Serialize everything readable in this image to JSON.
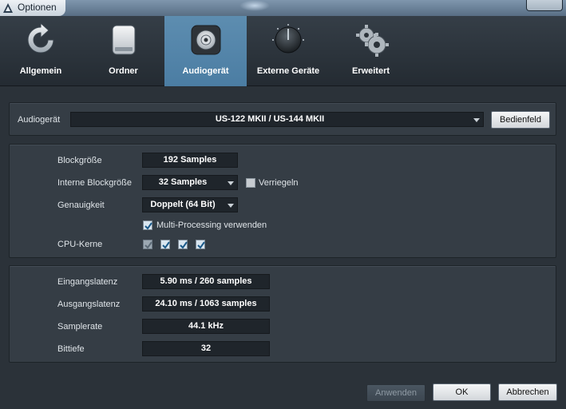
{
  "window": {
    "title": "Optionen"
  },
  "tabs": [
    {
      "label": "Allgemein",
      "icon": "refresh-icon"
    },
    {
      "label": "Ordner",
      "icon": "drive-icon"
    },
    {
      "label": "Audiogerät",
      "icon": "speaker-icon"
    },
    {
      "label": "Externe Geräte",
      "icon": "knob-icon"
    },
    {
      "label": "Erweitert",
      "icon": "gears-icon"
    }
  ],
  "active_tab": "Audiogerät",
  "device": {
    "label": "Audiogerät",
    "value": "US-122 MKII / US-144 MKII",
    "control_panel_button": "Bedienfeld"
  },
  "settings": {
    "block_size_label": "Blockgröße",
    "block_size_value": "192 Samples",
    "internal_block_size_label": "Interne Blockgröße",
    "internal_block_size_value": "32 Samples",
    "lock_label": "Verriegeln",
    "lock_checked": false,
    "precision_label": "Genauigkeit",
    "precision_value": "Doppelt (64 Bit)",
    "multiprocessing_label": "Multi-Processing verwenden",
    "multiprocessing_checked": true,
    "cpu_cores_label": "CPU-Kerne",
    "cpu_cores_checked": [
      true,
      true,
      true,
      true
    ]
  },
  "info": {
    "input_latency_label": "Eingangslatenz",
    "input_latency_value": "5.90 ms / 260 samples",
    "output_latency_label": "Ausgangslatenz",
    "output_latency_value": "24.10 ms / 1063 samples",
    "samplerate_label": "Samplerate",
    "samplerate_value": "44.1 kHz",
    "bit_depth_label": "Bittiefe",
    "bit_depth_value": "32"
  },
  "footer": {
    "apply_button": "Anwenden",
    "ok_button": "OK",
    "cancel_button": "Abbrechen"
  },
  "colors": {
    "accent": "#5a8aae",
    "background": "#2b3239",
    "panel": "#353d45",
    "field": "#1f252b"
  }
}
